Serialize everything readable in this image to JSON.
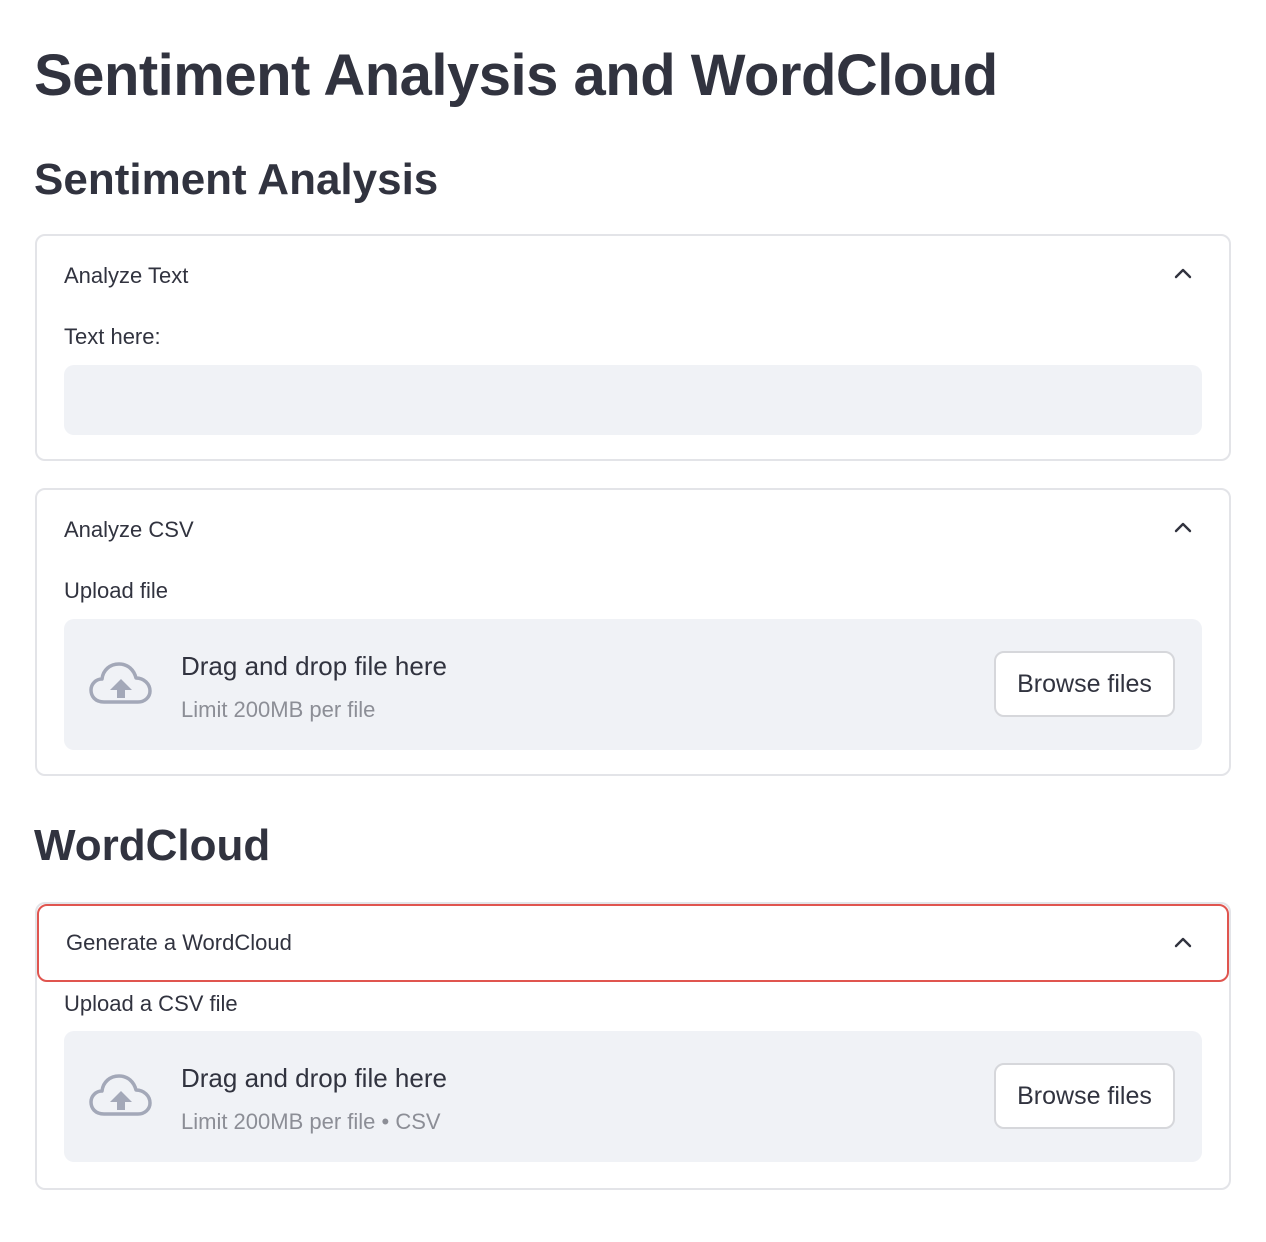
{
  "page": {
    "title": "Sentiment Analysis and WordCloud"
  },
  "sections": {
    "sentiment": {
      "title": "Sentiment Analysis"
    },
    "wordcloud": {
      "title": "WordCloud"
    }
  },
  "analyze_text": {
    "header": "Analyze Text",
    "input_label": "Text here:",
    "input_value": "",
    "input_placeholder": ""
  },
  "analyze_csv": {
    "header": "Analyze CSV",
    "upload_label": "Upload file",
    "dropzone_title": "Drag and drop file here",
    "dropzone_limit": "Limit 200MB per file",
    "browse_label": "Browse files"
  },
  "generate_wordcloud": {
    "header": "Generate a WordCloud",
    "upload_label": "Upload a CSV file",
    "dropzone_title": "Drag and drop file here",
    "dropzone_limit": "Limit 200MB per file • CSV",
    "browse_label": "Browse files"
  },
  "icons": {
    "chevron": "chevron-up-icon",
    "upload": "cloud-upload-icon"
  },
  "colors": {
    "text": "#31333f",
    "muted": "#8c8e96",
    "panel": "#f0f2f6",
    "border": "#e3e4e8",
    "focus": "#e0554f",
    "icon": "#a3a8b8"
  }
}
